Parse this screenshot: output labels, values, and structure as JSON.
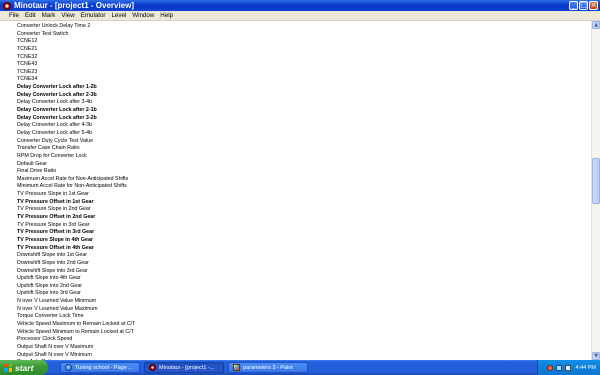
{
  "window": {
    "title": "Minotaur - [project1 - Overview]",
    "controls": {
      "minimize": "_",
      "maximize": "□",
      "close": "×"
    }
  },
  "menu": [
    "File",
    "Edit",
    "Mark",
    "View",
    "Emulator",
    "Level",
    "Window",
    "Help"
  ],
  "list": [
    {
      "label": "Converter Unlock Delay Time 2",
      "bold": false
    },
    {
      "label": "Converter Test Switch",
      "bold": false
    },
    {
      "label": "TCNE12",
      "bold": false
    },
    {
      "label": "TCNE21",
      "bold": false
    },
    {
      "label": "TCNE32",
      "bold": false
    },
    {
      "label": "TCNE43",
      "bold": false
    },
    {
      "label": "TCNE23",
      "bold": false
    },
    {
      "label": "TCNE34",
      "bold": false
    },
    {
      "label": "Delay Converter Lock after 1-2b",
      "bold": true
    },
    {
      "label": "Delay Converter Lock after 2-3b",
      "bold": true
    },
    {
      "label": "Delay Converter Lock after 3-4b",
      "bold": false
    },
    {
      "label": "Delay Converter Lock after 2-1b",
      "bold": true
    },
    {
      "label": "Delay Converter Lock after 3-2b",
      "bold": true
    },
    {
      "label": "Delay Converter Lock after 4-3b",
      "bold": false
    },
    {
      "label": "Delay Converter Lock after 5-4b",
      "bold": false
    },
    {
      "label": "Converter Duty Cycle Test Value",
      "bold": false
    },
    {
      "label": "Transfer Case Chain Ratio",
      "bold": false
    },
    {
      "label": "RPM Drop for Converter Lock",
      "bold": false
    },
    {
      "label": "Default Gear",
      "bold": false
    },
    {
      "label": "Final Drive Ratio",
      "bold": false
    },
    {
      "label": "Maximum Accel Rate for Non-Anticipated Shifts",
      "bold": false
    },
    {
      "label": "Minimum Accel Rate for Non-Anticipated Shifts",
      "bold": false
    },
    {
      "label": "TV Pressure Slope in 1st Gear",
      "bold": false
    },
    {
      "label": "TV Pressure Offset in 1st Gear",
      "bold": true
    },
    {
      "label": "TV Pressure Slope in 2nd Gear",
      "bold": false
    },
    {
      "label": "TV Pressure Offset in 2nd Gear",
      "bold": true
    },
    {
      "label": "TV Pressure Slope in 3rd Gear",
      "bold": false
    },
    {
      "label": "TV Pressure Offset in 3rd Gear",
      "bold": true
    },
    {
      "label": "TV Pressure Slope in 4th Gear",
      "bold": true
    },
    {
      "label": "TV Pressure Offset in 4th Gear",
      "bold": true
    },
    {
      "label": "Downshift Slope into 1st Gear",
      "bold": false
    },
    {
      "label": "Downshift Slope into 2nd Gear",
      "bold": false
    },
    {
      "label": "Downshift Slope into 3rd Gear",
      "bold": false
    },
    {
      "label": "Upshift Slope into 4th Gear",
      "bold": false
    },
    {
      "label": "Upshift Slope into 2nd Gear",
      "bold": false
    },
    {
      "label": "Upshift Slope into 3rd Gear",
      "bold": false
    },
    {
      "label": "N over V Learned Value Minimum",
      "bold": false
    },
    {
      "label": "N over V Learned Value Maximum",
      "bold": false
    },
    {
      "label": "Torque Converter Lock Time",
      "bold": false
    },
    {
      "label": "Vehicle Speed Maximum to Remain Locked at C/T",
      "bold": false
    },
    {
      "label": "Vehicle Speed Minimum to Remain Locked at C/T",
      "bold": false
    },
    {
      "label": "Processor Clock Speed",
      "bold": false
    },
    {
      "label": "Output Shaft N over V Maximum",
      "bold": false
    },
    {
      "label": "Output Shaft N over V Minimum",
      "bold": false
    },
    {
      "label": "Rear Axle Ratio",
      "bold": false
    }
  ],
  "scrollbar": {
    "up_glyph": "▲",
    "down_glyph": "▼"
  },
  "taskbar": {
    "start_label": "start",
    "tasks": [
      {
        "label": "Tuning school - Page ...",
        "icon": "internet-explorer-icon"
      },
      {
        "label": "Minotaur - [project1 -...",
        "icon": "minotaur-icon"
      },
      {
        "label": "parameters 3 - Paint",
        "icon": "paint-icon"
      }
    ],
    "clock": "4:44 PM"
  }
}
